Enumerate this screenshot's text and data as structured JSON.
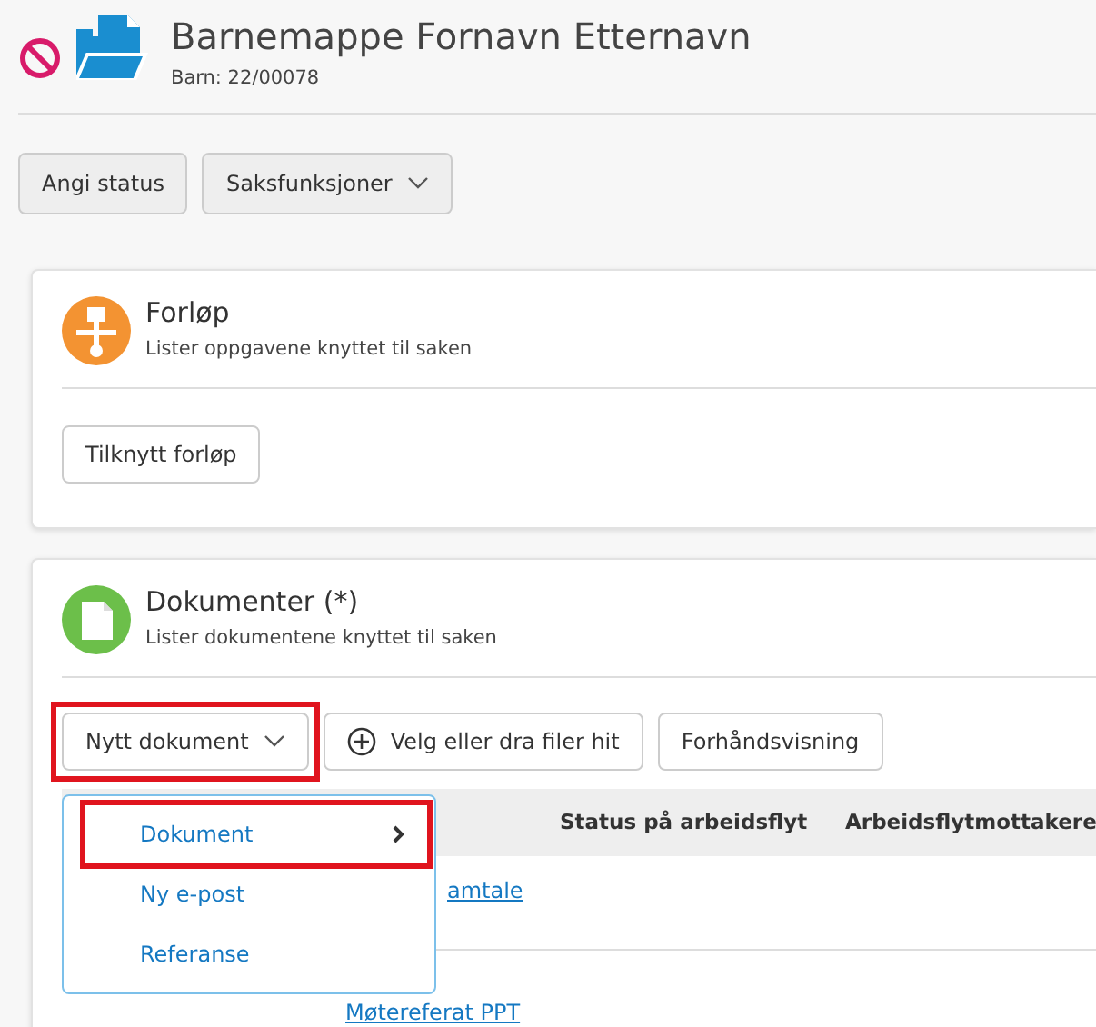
{
  "header": {
    "title": "Barnemappe Fornavn Etternavn",
    "subtitle": "Barn: 22/00078"
  },
  "actions": [
    {
      "label": "Angi status",
      "kind": "plain"
    },
    {
      "label": "Saksfunksjoner",
      "kind": "dropdown"
    }
  ],
  "forlop": {
    "title": "Forløp",
    "description": "Lister oppgavene knyttet til saken",
    "buttons": [
      "Tilknytt forløp"
    ]
  },
  "dokumenter": {
    "title": "Dokumenter (*)",
    "description": "Lister dokumentene knyttet til saken",
    "toolbar": [
      {
        "label": "Nytt dokument",
        "kind": "dropdown",
        "highlighted": true
      },
      {
        "label": "Velg eller dra filer hit",
        "kind": "upload",
        "highlighted": false
      },
      {
        "label": "Forhåndsvisning",
        "kind": "plain",
        "highlighted": false
      }
    ],
    "menu": [
      {
        "label": "Dokument",
        "submenu": true,
        "highlighted": true
      },
      {
        "label": "Ny e-post",
        "submenu": false,
        "highlighted": false
      },
      {
        "label": "Referanse",
        "submenu": false,
        "highlighted": false
      }
    ],
    "table": {
      "columns": [
        "Status på arbeidsflyt",
        "Arbeidsflytmottakere"
      ],
      "rows": [
        {
          "title": "amtale"
        },
        {
          "title": "Møtereferat PPT"
        }
      ]
    }
  }
}
